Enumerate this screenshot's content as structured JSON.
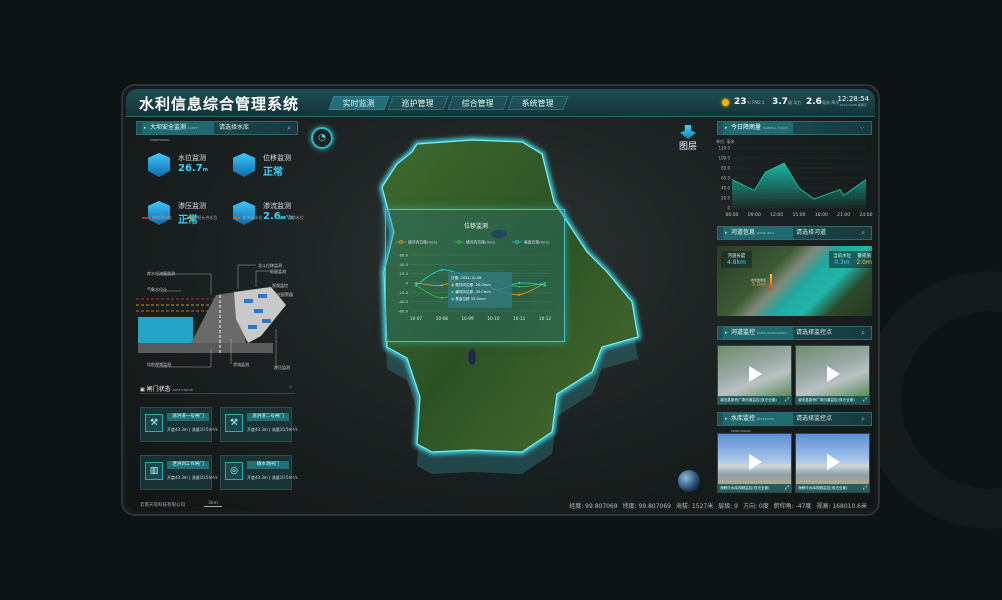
{
  "header": {
    "title": "水利信息综合管理系统",
    "nav": [
      "实时监测",
      "巡护管理",
      "综合管理",
      "系统管理"
    ],
    "active_nav": "实时监测",
    "weather": {
      "icon": "sun-icon",
      "temp": "23",
      "temp_unit": "℃ PM2.5",
      "wind": "3.7",
      "wind_unit": "级 风力",
      "rain": "2.6",
      "rain_unit": "毫米 降水",
      "time": "12:28:54",
      "date": "2021/10/08 星期五"
    }
  },
  "left": {
    "panel_title": "大坝安全监测",
    "panel_sub": "SAFETY MONITORING",
    "select": "请选择水库",
    "metrics": [
      {
        "label": "水位监测",
        "value": "26.7",
        "unit": "m",
        "icon": "water-level-icon"
      },
      {
        "label": "位移监测",
        "value": "正常",
        "unit": "",
        "icon": "anchor-icon"
      },
      {
        "label": "渗压监测",
        "value": "正常",
        "unit": "",
        "icon": "seepage-pressure-icon"
      },
      {
        "label": "渗流监测",
        "value": "2.6",
        "unit": "m³/s",
        "icon": "seepage-flow-icon"
      }
    ],
    "legend": [
      {
        "label": "校核洪水位",
        "color": "#c0272d"
      },
      {
        "label": "设计洪水位",
        "color": "#b8a020"
      },
      {
        "label": "防洪高水位",
        "color": "#c8692a"
      },
      {
        "label": "正常水位",
        "color": "#2aa0c8"
      }
    ],
    "dam_labels": [
      "库水位流量监测",
      "气象水位计",
      "坝前视频监测",
      "北斗位移监测",
      "雨量监测",
      "视频监控",
      "声光报警器",
      "渗流监测",
      "渗压监测"
    ],
    "gates_title": "闸门状态",
    "gates_sub": "GATE STATUS",
    "gates": [
      {
        "name": "溢洪道一号闸门",
        "value": "开度43.3m | 流量10.5m³/s"
      },
      {
        "name": "溢洪道二号闸门",
        "value": "开度43.3m | 流量10.5m³/s"
      },
      {
        "name": "泄洪洞工作闸门",
        "value": "开度43.3m | 流量10.5m³/s"
      },
      {
        "name": "输水洞闸门",
        "value": "开度43.3m | 流量10.5m³/s"
      }
    ],
    "company": "云南天际科技有限公司",
    "scale": "3km"
  },
  "map": {
    "layers_label": "图层",
    "footer": [
      "经度: 99.807069",
      "纬度: 99.807069",
      "海拔: 1527米",
      "层级: 9",
      "方向: 0度",
      "俯仰角: -47度",
      "视高: 168010.6米"
    ]
  },
  "popup": {
    "tooltip": {
      "date": "日期: 2021-10-08",
      "lines": [
        "顺河向位移 -20.0mm",
        "横河向位移 -35.0mm",
        "垂直位移 55.0mm"
      ]
    }
  },
  "right": {
    "rain_title": "今日降雨量",
    "rain_sub": "RAINFALL TODAY",
    "river_title": "河道信息",
    "river_sub": "RIVER INFO",
    "river_select": "请选择河道",
    "river": {
      "length_label": "河道长度",
      "length": "4.8km",
      "level_label": "当前水位",
      "level": "0.3m",
      "warn_label": "警戒值",
      "warn": "2.0m",
      "marker_label": "水位监测点",
      "marker_value": "3.0m"
    },
    "river_mon_title": "河道监控",
    "river_mon_sub": "RIVER MONITORING",
    "river_mon_select": "请选择监控点",
    "river_videos": [
      "澜沧县新桥广场河道监控(双光全景)",
      "澜沧县新桥广场河道监控(双光全景)"
    ],
    "res_mon_title": "水库监控",
    "res_mon_sub": "RESERVOIR MONITORING",
    "res_mon_select": "请选择监控点",
    "res_videos": [
      "海鲸可水库视频监控(双光全景)",
      "海鲸可水库视频监控(双光全景)"
    ]
  },
  "chart_data": [
    {
      "type": "area",
      "title": "今日降雨量",
      "ylabel": "单位: 毫米",
      "x": [
        "06:00",
        "09:00",
        "10:30",
        "13:00",
        "15:00",
        "17:00",
        "20:30",
        "21:00",
        "24:00"
      ],
      "x_ticks": [
        "06:00",
        "09:00",
        "12:00",
        "15:00",
        "18:00",
        "21:00",
        "24:00"
      ],
      "values": [
        57,
        35,
        72,
        90,
        40,
        18,
        37,
        25,
        57
      ],
      "ylim": [
        0,
        120
      ],
      "y_ticks": [
        "0",
        "20.0",
        "40.0",
        "60.0",
        "80.0",
        "100.0",
        "120.0"
      ],
      "color": "#19c7b0"
    },
    {
      "type": "line",
      "title": "位移监测",
      "categories": [
        "10-07",
        "10-08",
        "10-09",
        "10-10",
        "10-11",
        "10-12"
      ],
      "ylim": [
        -60,
        60
      ],
      "y_ticks": [
        "60.0",
        "40.0",
        "20.0",
        "0",
        "-20.0",
        "-40.0",
        "-60.0"
      ],
      "series": [
        {
          "name": "顺河向位移(mm)",
          "color": "#f0a020",
          "values": [
            0,
            -5,
            12,
            -12,
            -25,
            0
          ]
        },
        {
          "name": "横河向位移(mm)",
          "color": "#40c040",
          "values": [
            -5,
            -32,
            -10,
            5,
            -8,
            0
          ]
        },
        {
          "name": "垂直位移(mm)",
          "color": "#20d8e0",
          "values": [
            -5,
            28,
            10,
            -15,
            0,
            -5
          ]
        }
      ]
    }
  ]
}
